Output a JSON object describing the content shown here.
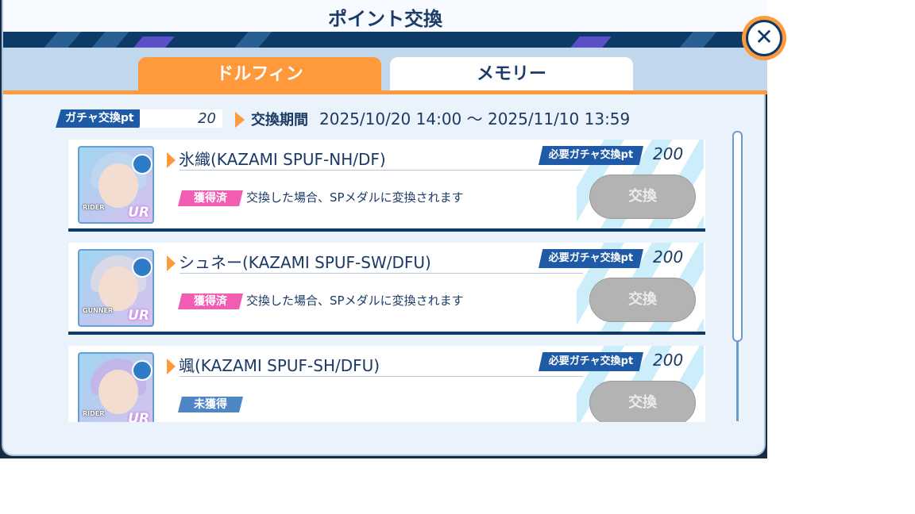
{
  "header": {
    "title": "ポイント交換",
    "close_label": "✕"
  },
  "tabs": [
    {
      "label": "ドルフィン",
      "active": true
    },
    {
      "label": "メモリー",
      "active": false
    }
  ],
  "points": {
    "label": "ガチャ交換pt",
    "value": "20"
  },
  "period": {
    "label": "交換期間",
    "value": "2025/10/20 14:00 〜 2025/11/10 13:59"
  },
  "items": [
    {
      "name": "氷織(KAZAMI SPUF-NH/DF)",
      "cost_label": "必要ガチャ交換pt",
      "cost": "200",
      "status": "獲得済",
      "note": "交換した場合、SPメダルに変換されます",
      "button": "交換",
      "rarity": "UR",
      "role": "RIDER"
    },
    {
      "name": "シュネー(KAZAMI SPUF-SW/DFU)",
      "cost_label": "必要ガチャ交換pt",
      "cost": "200",
      "status": "獲得済",
      "note": "交換した場合、SPメダルに変換されます",
      "button": "交換",
      "rarity": "UR",
      "role": "GUNNER"
    },
    {
      "name": "颯(KAZAMI SPUF-SH/DFU)",
      "cost_label": "必要ガチャ交換pt",
      "cost": "200",
      "status": "未獲得",
      "note": "",
      "button": "交換",
      "rarity": "UR",
      "role": "RIDER"
    }
  ],
  "colors": {
    "accent": "#ff9a3c",
    "navy": "#0d3a66",
    "owned": "#f25cb3",
    "unowned": "#4f86c6"
  }
}
